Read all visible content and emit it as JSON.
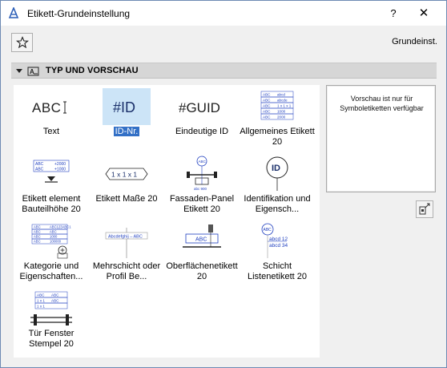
{
  "window": {
    "title": "Etikett-Grundeinstellung",
    "help_glyph": "?",
    "close_glyph": "✕"
  },
  "toolbar": {
    "favorite_icon": "star-icon",
    "label": "Grundeinst."
  },
  "section": {
    "title": "TYP UND VORSCHAU",
    "icon": "label-settings-icon"
  },
  "selected_index": 1,
  "items": [
    {
      "label": "Text",
      "glyph": "ABC",
      "icon": "text-label-icon"
    },
    {
      "label": "ID-Nr.",
      "glyph": "#ID",
      "icon": "id-label-icon"
    },
    {
      "label": "Eindeutige ID",
      "glyph": "#GUID",
      "icon": "guid-label-icon"
    },
    {
      "label": "Allgemeines Etikett 20",
      "icon": "general-label-icon"
    },
    {
      "label": "Etikett element Bauteilhöhe 20",
      "icon": "element-height-label-icon"
    },
    {
      "label": "Etikett Maße 20",
      "glyph": "1 x 1 x 1",
      "icon": "dimension-label-icon"
    },
    {
      "label": "Fassaden-Panel Etikett 20",
      "icon": "facade-panel-label-icon"
    },
    {
      "label": "Identifikation und Eigensch...",
      "glyph": "ID",
      "icon": "identification-label-icon"
    },
    {
      "label": "Kategorie und Eigenschaften...",
      "icon": "category-label-icon"
    },
    {
      "label": "Mehrschicht oder Profil Be...",
      "glyph": "Abcdefghij – ABC",
      "icon": "composite-label-icon"
    },
    {
      "label": "Oberflächenetikett 20",
      "glyph": "ABC",
      "icon": "surface-label-icon"
    },
    {
      "label": "Schicht Listenetikett 20",
      "icon": "layer-list-label-icon"
    },
    {
      "label": "Tür Fenster Stempel 20",
      "icon": "door-window-stamp-icon"
    }
  ],
  "thumb_text": {
    "general_rows": [
      "ABC",
      "abcd",
      "ABC",
      "abcde",
      "ABC",
      "1 x 1 x 1",
      "ABC",
      "1000",
      "ABC",
      "2000"
    ],
    "element_height_rows": [
      "ABC",
      "+2000",
      "ABC",
      "+1000"
    ],
    "facade_badge": "ABC",
    "facade_sub": "abc 900",
    "category_rows": [
      "ABC",
      "ABC123ABC1",
      "ABC",
      "ABC",
      "ABC",
      "1000",
      "ABC",
      "100000"
    ],
    "layer_badge": "ABC",
    "layer_rows": [
      "abcd 12",
      "abcd 34"
    ],
    "door_rows": [
      "ABC",
      "ABC",
      "1 x 1",
      "ABC",
      "1 x 1"
    ]
  },
  "preview": {
    "message": "Vorschau ist nur für Symboletiketten verfügbar",
    "button_icon": "preview-options-icon"
  },
  "colors": {
    "selection": "#3370c6",
    "selection_bg": "#cce4f7",
    "label_blue": "#1f3fbf",
    "header_bg": "#d6d6d6"
  }
}
